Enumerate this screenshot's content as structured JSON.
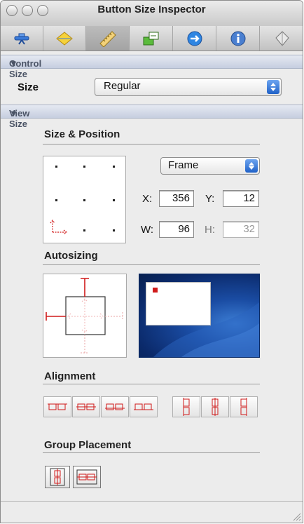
{
  "window": {
    "title": "Button Size Inspector"
  },
  "toolbar": {
    "tabs": [
      {
        "icon": "attributes-icon",
        "selected": false
      },
      {
        "icon": "effects-icon",
        "selected": false
      },
      {
        "icon": "size-ruler-icon",
        "selected": true
      },
      {
        "icon": "connections-icon",
        "selected": false
      },
      {
        "icon": "bindings-icon",
        "selected": false
      },
      {
        "icon": "identity-icon",
        "selected": false
      },
      {
        "icon": "applescript-icon",
        "selected": false
      }
    ]
  },
  "control_size": {
    "section_title": "Control Size",
    "size_label": "Size",
    "size_value": "Regular"
  },
  "view_size": {
    "section_title": "View Size",
    "size_position_title": "Size & Position",
    "frame_popup": "Frame",
    "x_label": "X:",
    "x_value": "356",
    "y_label": "Y:",
    "y_value": "12",
    "w_label": "W:",
    "w_value": "96",
    "h_label": "H:",
    "h_value": "32",
    "autosizing_title": "Autosizing",
    "alignment_title": "Alignment",
    "group_placement_title": "Group Placement"
  },
  "colors": {
    "accent_blue": "#1f61c8",
    "spring_red": "#d01a1a",
    "preview_bg": "#103c8a"
  }
}
